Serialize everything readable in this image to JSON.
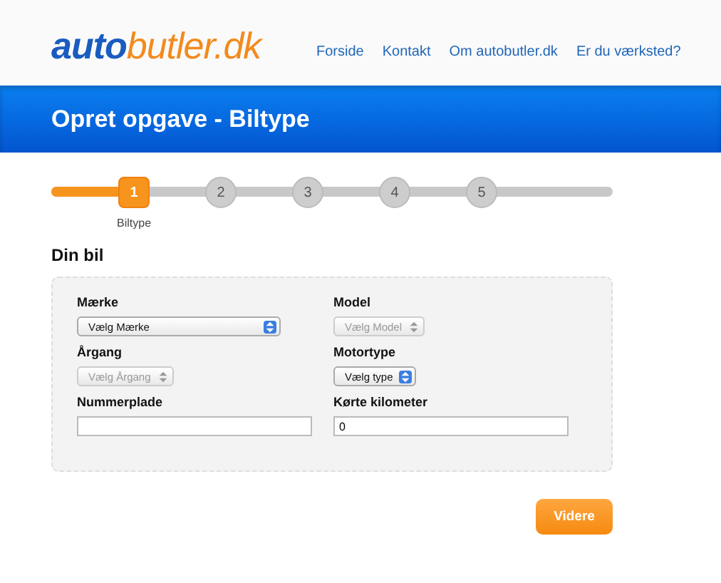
{
  "logo": {
    "part_1": "auto",
    "part_2": "butler.dk"
  },
  "nav": [
    "Forside",
    "Kontakt",
    "Om autobutler.dk",
    "Er du værksted?"
  ],
  "banner": {
    "title": "Opret opgave - Biltype"
  },
  "stepper": {
    "level": 0.15,
    "steps": [
      {
        "number": "1",
        "selected": true,
        "label": "Biltype"
      },
      {
        "number": "2",
        "selected": false
      },
      {
        "number": "3",
        "selected": false
      },
      {
        "number": "4",
        "selected": false
      },
      {
        "number": "5",
        "selected": false
      }
    ]
  },
  "section_title": "Din bil",
  "fields": [
    {
      "kind": "select",
      "label": "Mærke",
      "value": "Vælg Mærke",
      "disabled": false,
      "wide": true
    },
    {
      "kind": "select",
      "label": "Model",
      "value": "Vælg Model",
      "disabled": true,
      "wide": false
    },
    {
      "kind": "select",
      "label": "Årgang",
      "value": "Vælg Årgang",
      "disabled": true,
      "wide": false
    },
    {
      "kind": "select",
      "label": "Motortype",
      "value": "Vælg type",
      "disabled": false,
      "wide": false
    },
    {
      "kind": "text",
      "label": "Nummerplade"
    },
    {
      "kind": "text",
      "label": "Kørte kilometer",
      "value": "0"
    }
  ],
  "next_button": "Videre"
}
